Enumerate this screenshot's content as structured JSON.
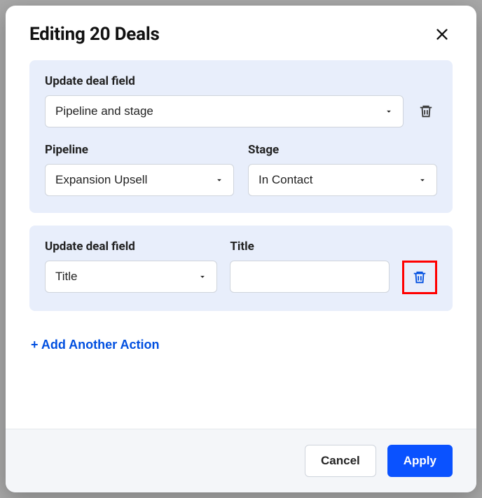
{
  "header": {
    "title": "Editing 20 Deals"
  },
  "actions": [
    {
      "field_label": "Update deal field",
      "field_value": "Pipeline and stage",
      "sub": {
        "pipeline_label": "Pipeline",
        "pipeline_value": "Expansion Upsell",
        "stage_label": "Stage",
        "stage_value": "In Contact"
      }
    },
    {
      "field_label": "Update deal field",
      "field_value": "Title",
      "title_label": "Title",
      "title_value": ""
    }
  ],
  "add_action_label": "+ Add Another Action",
  "footer": {
    "cancel": "Cancel",
    "apply": "Apply"
  },
  "colors": {
    "panel_bg": "#e8eefb",
    "primary": "#0a52ff",
    "highlight_border": "#ff0000"
  }
}
